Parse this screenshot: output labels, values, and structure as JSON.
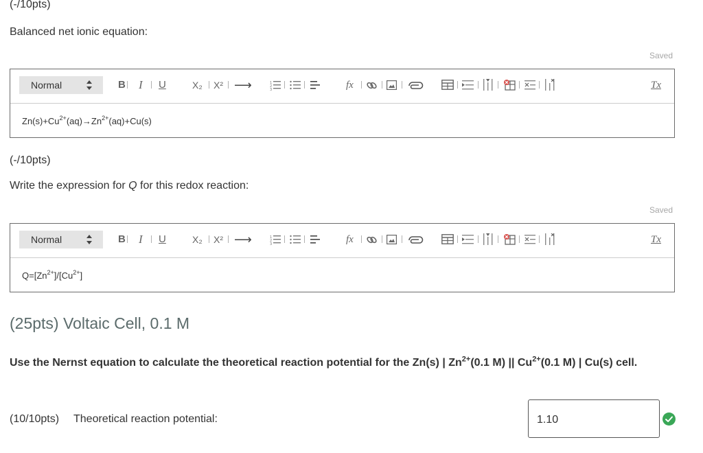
{
  "q1": {
    "points": "(-/10pts)",
    "prompt": "Balanced net ionic equation:",
    "saved": "Saved",
    "format": "Normal",
    "content": {
      "p1": "Zn(s)+Cu",
      "s1": "2+",
      "p2": "(aq)→Zn",
      "s2": "2+",
      "p3": "(aq)+Cu(s)"
    }
  },
  "q2": {
    "points": "(-/10pts)",
    "prompt_pre": "Write the expression for ",
    "prompt_var": "Q",
    "prompt_post": " for this redox reaction:",
    "saved": "Saved",
    "format": "Normal",
    "content": {
      "p1": "Q=[Zn",
      "s1": "2+",
      "p2": "]/[Cu",
      "s2": "2+",
      "p3": "]"
    }
  },
  "toolbar": {
    "bold": "B",
    "italic": "I",
    "underline": "U",
    "subscript": "X₂",
    "superscript": "X²",
    "arrow": "⟶",
    "formula": "fx",
    "clear": "Tx"
  },
  "section": {
    "title": "(25pts) Voltaic Cell, 0.1 M",
    "instruction": {
      "p1": "Use the Nernst equation to calculate the theoretical reaction potential for the Zn(s) | Zn",
      "s1": "2+",
      "p2": "(0.1 M) || Cu",
      "s2": "2+",
      "p3": "(0.1 M) | Cu(s) cell."
    }
  },
  "q3": {
    "points": "(10/10pts)",
    "prompt": "Theoretical reaction potential:",
    "answer": "1.10",
    "status": "correct"
  },
  "colors": {
    "section_title": "#5b6b6b",
    "check": "#3aa757",
    "select_bg": "#e4e4e4"
  }
}
